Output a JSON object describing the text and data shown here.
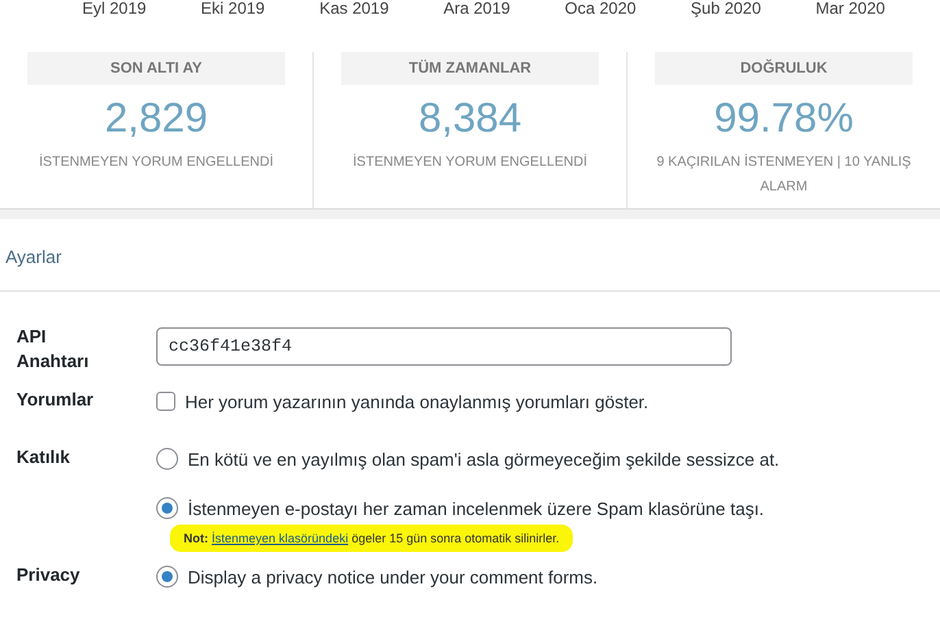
{
  "chart_axis": {
    "months": [
      "Eyl 2019",
      "Eki 2019",
      "Kas 2019",
      "Ara 2019",
      "Oca 2020",
      "Şub 2020",
      "Mar 2020"
    ]
  },
  "stats": [
    {
      "title": "SON ALTI AY",
      "value": "2,829",
      "caption": "İSTENMEYEN YORUM ENGELLENDİ"
    },
    {
      "title": "TÜM ZAMANLAR",
      "value": "8,384",
      "caption": "İSTENMEYEN YORUM ENGELLENDİ"
    },
    {
      "title": "DOĞRULUK",
      "value": "99.78%",
      "caption": "9 KAÇIRILAN İSTENMEYEN | 10 YANLIŞ ALARM"
    }
  ],
  "settings": {
    "title": "Ayarlar",
    "api_key": {
      "label": "API Anahtarı",
      "value": "cc36f41e38f4"
    },
    "comments": {
      "label": "Yorumlar",
      "option": "Her yorum yazarının yanında onaylanmış yorumları göster.",
      "checked": false
    },
    "strictness": {
      "label": "Katılık",
      "options": [
        {
          "text": "En kötü ve en yayılmış olan spam'i asla görmeyeceğim şekilde sessizce at.",
          "selected": false
        },
        {
          "text": "İstenmeyen e-postayı her zaman incelenmek üzere Spam klasörüne taşı.",
          "selected": true
        }
      ],
      "note": {
        "prefix": "Not:",
        "link": "İstenmeyen klasöründeki",
        "text": "ögeler 15 gün sonra otomatik silinirler.",
        "highlighted": true
      }
    },
    "privacy": {
      "label": "Privacy",
      "options": [
        {
          "text": "Display a privacy notice under your comment forms.",
          "selected": true
        }
      ]
    }
  }
}
